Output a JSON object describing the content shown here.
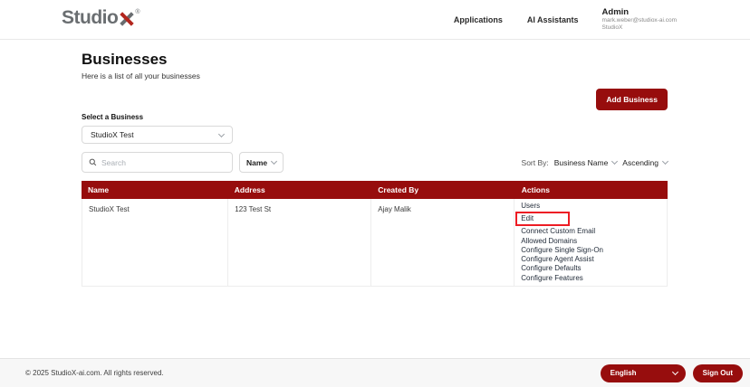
{
  "header": {
    "logo": {
      "text": "Studio",
      "x": "X",
      "registered": "®"
    },
    "nav": [
      {
        "label": "Applications"
      },
      {
        "label": "AI Assistants"
      }
    ],
    "user": {
      "name": "Admin",
      "email": "mark.weber@studiox-ai.com",
      "org": "StudioX"
    }
  },
  "page": {
    "title": "Businesses",
    "subtitle": "Here is a list of all your businesses",
    "add_business_label": "Add Business",
    "select_business_label": "Select a Business",
    "selected_business": "StudioX Test",
    "search_placeholder": "Search",
    "filter_field": "Name",
    "sort": {
      "label": "Sort By:",
      "field": "Business Name",
      "direction": "Ascending"
    }
  },
  "table": {
    "columns": [
      "Name",
      "Address",
      "Created By",
      "Actions"
    ],
    "rows": [
      {
        "name": "StudioX Test",
        "address": "123 Test St",
        "created_by": "Ajay Malik",
        "actions": [
          "Users",
          "Edit",
          "Connect Custom Email",
          "Allowed Domains",
          "Configure Single Sign-On",
          "Configure Agent Assist",
          "Configure Defaults",
          "Configure Features"
        ],
        "highlighted_action": "Edit"
      }
    ]
  },
  "footer": {
    "copyright": "© 2025 StudioX-ai.com.  All rights reserved.",
    "language": "English",
    "sign_out_label": "Sign Out"
  },
  "colors": {
    "brand_red": "#970d0d",
    "highlight_red": "#ed1c24",
    "logo_gray": "#6a6e71"
  }
}
